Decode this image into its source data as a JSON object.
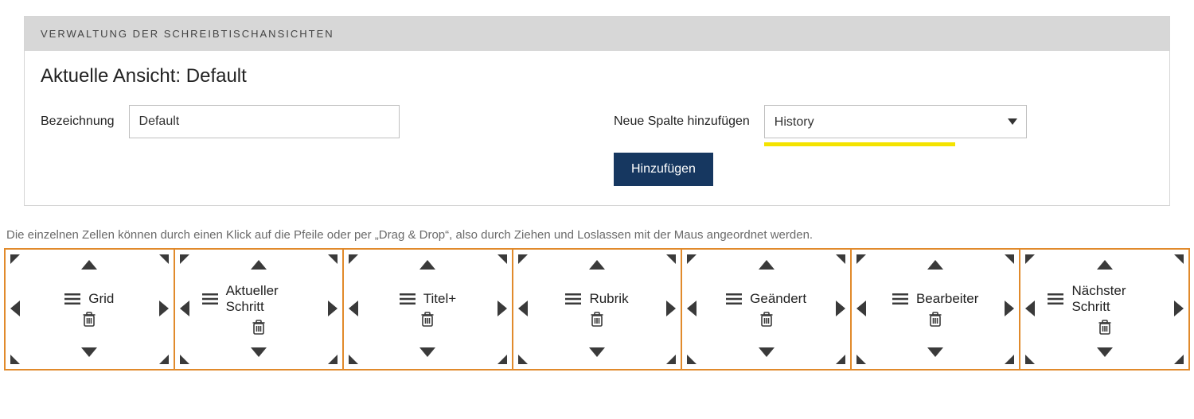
{
  "panel": {
    "header": "VERWALTUNG DER SCHREIBTISCHANSICHTEN",
    "current_view_prefix": "Aktuelle Ansicht: ",
    "current_view_name": "Default"
  },
  "form": {
    "name_label": "Bezeichnung",
    "name_value": "Default",
    "add_column_label": "Neue Spalte hinzufügen",
    "add_column_selected": "History",
    "add_button_label": "Hinzufügen"
  },
  "hint": "Die einzelnen Zellen können durch einen Klick auf die Pfeile oder per „Drag & Drop“, also durch Ziehen und Loslassen mit der Maus angeordnet werden.",
  "cells": [
    {
      "label": "Grid"
    },
    {
      "label": "Aktueller Schritt"
    },
    {
      "label": "Titel+"
    },
    {
      "label": "Rubrik"
    },
    {
      "label": "Geändert"
    },
    {
      "label": "Bearbeiter"
    },
    {
      "label": "Nächster Schritt"
    }
  ]
}
